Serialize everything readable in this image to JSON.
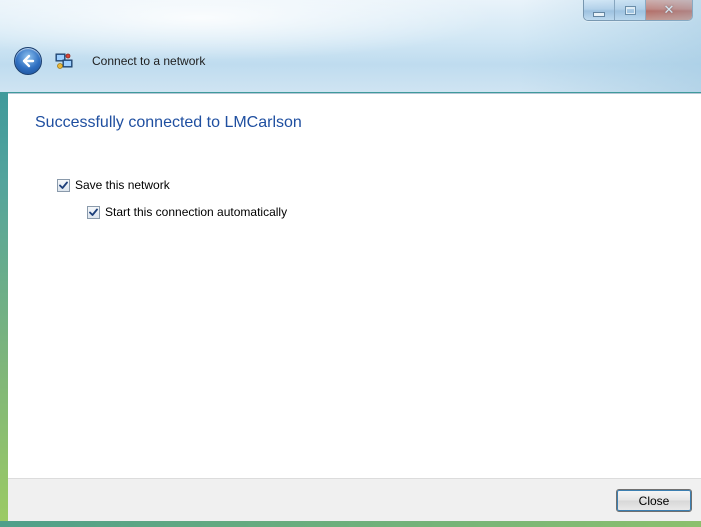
{
  "window": {
    "title": "Connect to a network",
    "caption": {
      "minimize": "minimize-icon",
      "maximize": "maximize-icon",
      "close": "close-icon"
    }
  },
  "nav": {
    "back_icon": "back-arrow-icon",
    "network_icon": "network-icon"
  },
  "main": {
    "headline": "Successfully connected to LMCarlson",
    "options": [
      {
        "label": "Save this network",
        "checked": true
      },
      {
        "label": "Start this connection automatically",
        "checked": true
      }
    ]
  },
  "footer": {
    "close_label": "Close"
  },
  "colors": {
    "headline": "#1f4fa0",
    "close_caption": "#c0391f"
  }
}
